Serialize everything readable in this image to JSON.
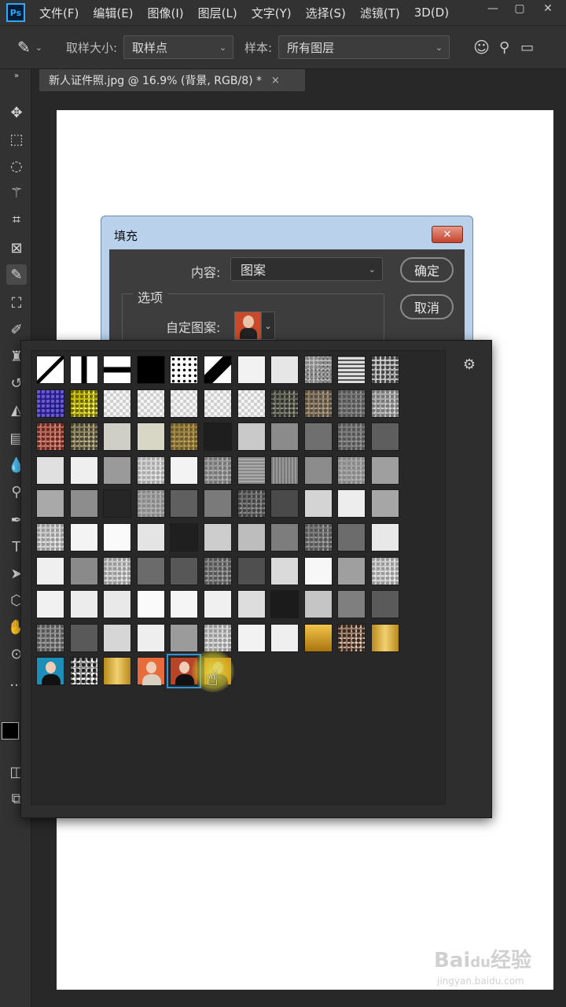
{
  "menubar": {
    "logo": "Ps",
    "items": [
      "文件(F)",
      "编辑(E)",
      "图像(I)",
      "图层(L)",
      "文字(Y)",
      "选择(S)",
      "滤镜(T)",
      "3D(D)"
    ]
  },
  "options": {
    "sample_size_label": "取样大小:",
    "sample_size_value": "取样点",
    "sample_label": "样本:",
    "sample_value": "所有图层"
  },
  "document_tab": {
    "title": "新人证件照.jpg @ 16.9% (背景, RGB/8) *",
    "close": "×"
  },
  "dialog": {
    "title": "填充",
    "close": "✕",
    "contents_label": "内容:",
    "contents_value": "图案",
    "ok": "确定",
    "cancel": "取消",
    "options_legend": "选项",
    "custom_pattern_label": "自定图案:"
  },
  "pattern_picker": {
    "selected_index": 4,
    "gear_icon": "gear-icon"
  },
  "watermark": {
    "text": "Bai du 经验",
    "sub": "jingyan.baidu.com"
  }
}
